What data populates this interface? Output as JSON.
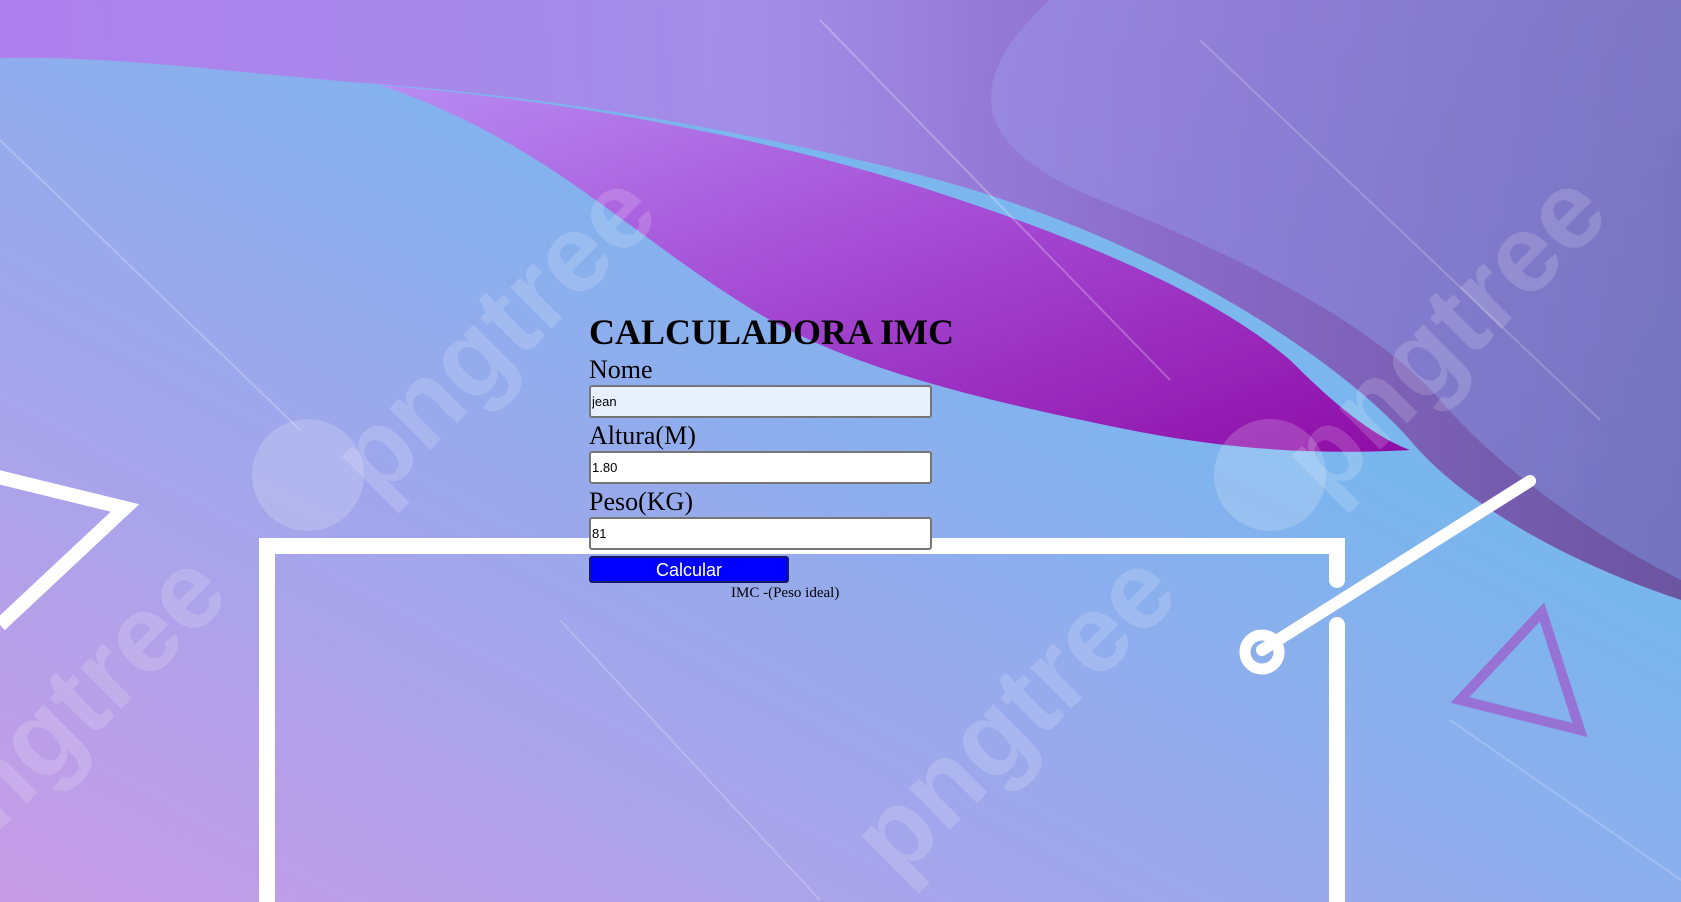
{
  "page": {
    "title": "CALCULADORA IMC"
  },
  "form": {
    "name_label": "Nome",
    "name_value": "jean",
    "height_label": "Altura(M)",
    "height_value": "1.80",
    "weight_label": "Peso(KG)",
    "weight_value": "81",
    "submit_label": "Calcular",
    "result_text": "IMC -(Peso ideal)"
  },
  "background": {
    "watermark_text": "pngtree",
    "colors": {
      "sky_blue": "#7db8ee",
      "lavender": "#a99ae8",
      "magenta_wave": "#9a1bbf",
      "deep_purple": "#6b4f9e"
    }
  },
  "colors": {
    "button_bg": "#0000ff",
    "button_text": "#ffffff",
    "autofill_bg": "#e8f0fe"
  }
}
